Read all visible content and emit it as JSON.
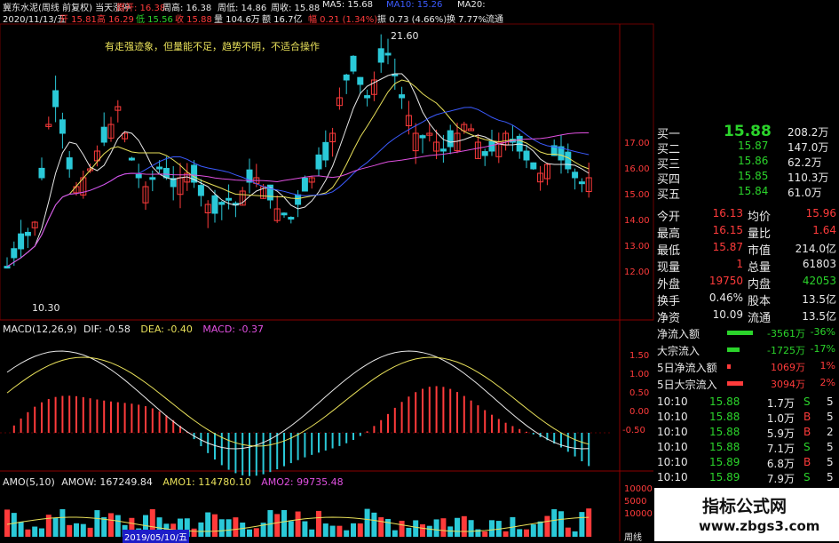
{
  "header": {
    "line1": [
      {
        "t": "冀东水泥(周线 前复权) 当天涨停",
        "c": "#e8e8e8"
      },
      {
        "t": "周开: 16.38",
        "c": "#ff3b3b"
      },
      {
        "t": "周高: 16.38",
        "c": "#e8e8e8"
      },
      {
        "t": "周低: 14.86",
        "c": "#e8e8e8"
      },
      {
        "t": "周收: 15.88",
        "c": "#e8e8e8"
      },
      {
        "t": "MA5: 15.68",
        "c": "#e8e8e8"
      },
      {
        "t": "MA10: 15.26",
        "c": "#3b5bff"
      },
      {
        "t": "MA20:",
        "c": "#e8e8e8"
      }
    ],
    "line2": [
      {
        "t": "2020/11/13/五",
        "c": "#e8e8e8"
      },
      {
        "t": "开 15.81",
        "c": "#ff3b3b"
      },
      {
        "t": "高 16.29",
        "c": "#ff3b3b"
      },
      {
        "t": "低 15.56",
        "c": "#2bd42b"
      },
      {
        "t": "收 15.88",
        "c": "#ff3b3b"
      },
      {
        "t": "量 104.6万",
        "c": "#e8e8e8"
      },
      {
        "t": "额 16.7亿",
        "c": "#e8e8e8"
      },
      {
        "t": "幅 0.21 (1.34%)",
        "c": "#ff3b3b"
      },
      {
        "t": "振 0.73 (4.66%)",
        "c": "#e8e8e8"
      },
      {
        "t": "换 7.77%",
        "c": "#e8e8e8"
      },
      {
        "t": "流通",
        "c": "#e8e8e8"
      }
    ],
    "note": "有走强迹象，但量能不足，趋势不明，不适合操作",
    "high_label": "21.60",
    "low_label": "10.30"
  },
  "price_axis": [
    "17.00",
    "16.00",
    "15.00",
    "14.00",
    "13.00",
    "12.00"
  ],
  "macd": {
    "title": "MACD(12,26,9)",
    "dif": "DIF: -0.58",
    "dea": "DEA: -0.40",
    "macd": "MACD: -0.37",
    "axis": [
      "1.50",
      "1.00",
      "0.50",
      "0.00",
      "-0.50"
    ]
  },
  "amo": {
    "title": "AMO(5,10)",
    "amow": "AMOW: 167249.84",
    "amo1": "AMO1: 114780.10",
    "amo2": "AMO2: 99735.48",
    "axis": [
      "10000",
      "5000",
      "10000"
    ]
  },
  "bottom": {
    "date_label": "2019/05/10/五",
    "period": "周线"
  },
  "orderbook": [
    {
      "label": "买一",
      "price": "15.88",
      "vol": "208.2万"
    },
    {
      "label": "买二",
      "price": "15.87",
      "vol": "147.0万"
    },
    {
      "label": "买三",
      "price": "15.86",
      "vol": "62.2万"
    },
    {
      "label": "买四",
      "price": "15.85",
      "vol": "110.3万"
    },
    {
      "label": "买五",
      "price": "15.84",
      "vol": "61.0万"
    }
  ],
  "quote": [
    {
      "l1": "今开",
      "v1": "16.13",
      "c1": "red",
      "l2": "均价",
      "v2": "15.96",
      "c2": "red"
    },
    {
      "l1": "最高",
      "v1": "16.15",
      "c1": "red",
      "l2": "量比",
      "v2": "1.64",
      "c2": "red"
    },
    {
      "l1": "最低",
      "v1": "15.87",
      "c1": "red",
      "l2": "市值",
      "v2": "214.0亿",
      "c2": "white"
    },
    {
      "l1": "现量",
      "v1": "1",
      "c1": "red",
      "l2": "总量",
      "v2": "61803",
      "c2": "white"
    },
    {
      "l1": "外盘",
      "v1": "19750",
      "c1": "red",
      "l2": "内盘",
      "v2": "42053",
      "c2": "green"
    },
    {
      "l1": "换手",
      "v1": "0.46%",
      "c1": "white",
      "l2": "股本",
      "v2": "13.5亿",
      "c2": "white"
    },
    {
      "l1": "净资",
      "v1": "10.09",
      "c1": "white",
      "l2": "流通",
      "v2": "13.5亿",
      "c2": "white"
    }
  ],
  "flows": [
    {
      "label": "净流入额",
      "value": "-3561万",
      "pct": "-36%",
      "bar": "#2bd42b",
      "vc": "green",
      "level": 0.9
    },
    {
      "label": "大宗流入",
      "value": "-1725万",
      "pct": "-17%",
      "bar": "#2bd42b",
      "vc": "green",
      "level": 0.45
    },
    {
      "label": "5日净流入额",
      "value": "1069万",
      "pct": "1%",
      "bar": "#ff3b3b",
      "vc": "red",
      "level": 0.12
    },
    {
      "label": "5日大宗流入",
      "value": "3094万",
      "pct": "2%",
      "bar": "#ff3b3b",
      "vc": "red",
      "level": 0.55
    }
  ],
  "ticks": [
    {
      "time": "10:10",
      "price": "15.88",
      "vol": "1.7万",
      "side": "S",
      "n": "5"
    },
    {
      "time": "10:10",
      "price": "15.88",
      "vol": "1.0万",
      "side": "B",
      "n": "5"
    },
    {
      "time": "10:10",
      "price": "15.88",
      "vol": "5.9万",
      "side": "B",
      "n": "2"
    },
    {
      "time": "10:10",
      "price": "15.88",
      "vol": "7.1万",
      "side": "S",
      "n": "5"
    },
    {
      "time": "10:10",
      "price": "15.89",
      "vol": "6.8万",
      "side": "B",
      "n": "5"
    },
    {
      "time": "10:10",
      "price": "15.89",
      "vol": "7.9万",
      "side": "S",
      "n": "5"
    }
  ],
  "watermark": {
    "line1": "指标公式网",
    "line2": "www.zbgs3.com"
  },
  "colors": {
    "up": "#ff3b3b",
    "down": "#2ac9d8",
    "bg": "#000000",
    "grid": "#5a0000"
  }
}
